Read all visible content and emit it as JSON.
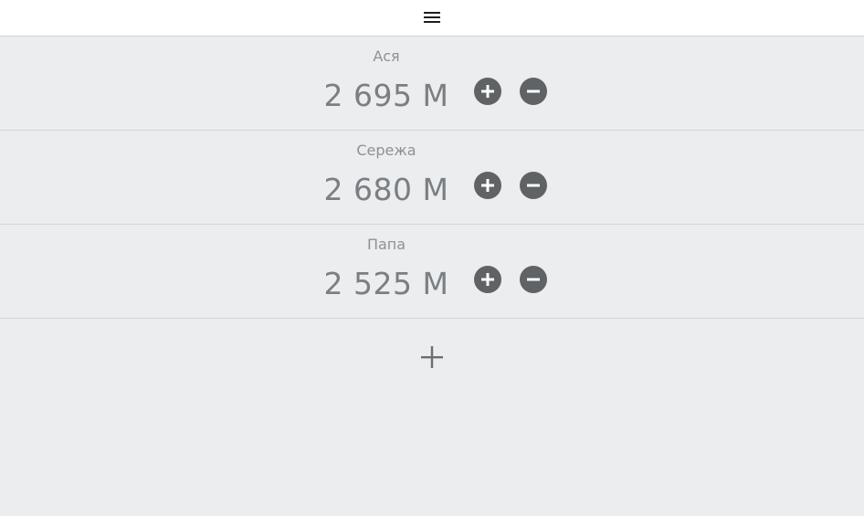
{
  "header": {
    "menu_icon": "menu-icon"
  },
  "players": [
    {
      "name": "Ася",
      "score": "2 695 M"
    },
    {
      "name": "Сережа",
      "score": "2 680 M"
    },
    {
      "name": "Папа",
      "score": "2 525 M"
    }
  ],
  "controls": {
    "increment_icon": "plus-circle-icon",
    "decrement_icon": "minus-circle-icon",
    "add_player_icon": "plus-icon"
  },
  "colors": {
    "background": "#ebedef",
    "header": "#ffffff",
    "button": "#5f6366",
    "text": "#7a7f83"
  }
}
